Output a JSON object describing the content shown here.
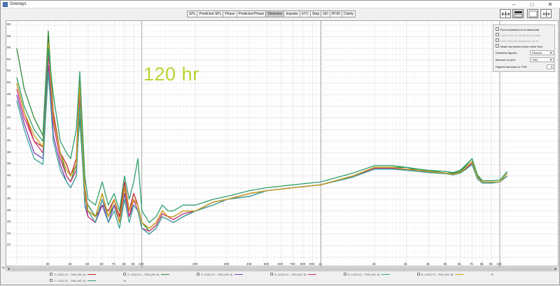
{
  "window": {
    "title": "Overlays"
  },
  "tabs": [
    "SPL",
    "Predicted SPL",
    "Phase",
    "Predicted Phase",
    "Distortion",
    "Impulse",
    "ETC",
    "Step",
    "GD",
    "RT60",
    "Clarity"
  ],
  "active_tab": "Distortion",
  "watermark": "120 hr",
  "options": {
    "plot_normalised": "Plot normalised to fundamental",
    "limit_norm": "Limit norm. to 30 dB below peak",
    "use_harmonic_freq": "Use harmonic frequency as ref",
    "mask_harmonics": "Mask harmonics below noise floor",
    "distortion_figures_label": "Distortion figures:",
    "distortion_figures_value": "Percent",
    "measure_to_plot_label": "Measure to plot:",
    "measure_to_plot_value": "THD",
    "highest_harmonic_label": "Highest harmonic in THD",
    "highest_harmonic_value": "9"
  },
  "y_position_readout": "80.41",
  "legend": [
    {
      "label": "1: LCD2 Cl... THD (H2..9)",
      "unit": "%",
      "color": "#c0272d"
    },
    {
      "label": "2: LCD2 Cl... THD (H2..9)",
      "unit": "%",
      "color": "#2f8a3a"
    },
    {
      "label": "3: LCD2 Cl... THD (H2..9)",
      "unit": "%",
      "color": "#7b3fb5"
    },
    {
      "label": "4: LCD2 Cl... THD (H2..9)",
      "unit": "%",
      "color": "#d6337a"
    },
    {
      "label": "5: LCD2 Cl... THD (H2..9)",
      "unit": "%",
      "color": "#3aa39a"
    },
    {
      "label": "6: LCD2 Cl... THD (H2..9)",
      "unit": "%",
      "color": "#c9a21a"
    },
    {
      "label": "7: LCD2 Cl... THD (H2..9)",
      "unit": "%",
      "color": "#2f9f6a"
    }
  ],
  "chart_data": {
    "type": "line",
    "title": "",
    "xlabel": "",
    "ylabel": "",
    "x_scale": "log",
    "xlim": [
      20,
      20000
    ],
    "ylim": [
      20,
      60
    ],
    "y_ticks": [
      22,
      24,
      26,
      28,
      30,
      32,
      34,
      36,
      38,
      40,
      42,
      44,
      46,
      48,
      50,
      52,
      54,
      56,
      58,
      60
    ],
    "x_tick_labels": [
      "30",
      "40",
      "50",
      "60",
      "70",
      "80",
      "90",
      "100",
      "200",
      "300",
      "400",
      "500",
      "600",
      "700",
      "800",
      "900",
      "1k",
      "2k",
      "3k",
      "4k",
      "5k",
      "6k",
      "7k",
      "8k",
      "9k",
      "10k"
    ],
    "x_ticks_hz": [
      30,
      40,
      50,
      60,
      70,
      80,
      90,
      100,
      200,
      300,
      400,
      500,
      600,
      700,
      800,
      900,
      1000,
      2000,
      3000,
      4000,
      5000,
      6000,
      7000,
      8000,
      9000,
      10000
    ],
    "x": [
      20,
      22,
      25,
      28,
      30,
      32,
      35,
      38,
      40,
      43,
      45,
      48,
      50,
      55,
      60,
      65,
      70,
      75,
      80,
      85,
      90,
      95,
      100,
      110,
      120,
      130,
      140,
      150,
      170,
      200,
      250,
      300,
      400,
      500,
      700,
      1000,
      1500,
      2000,
      2500,
      3000,
      3500,
      4000,
      5000,
      5500,
      6000,
      6500,
      7000,
      7500,
      8000,
      9000,
      10000,
      11000
    ],
    "series": [
      {
        "name": "1: LCD2 Cl... THD (H2..9)",
        "color": "#c0272d",
        "values": [
          50,
          45,
          40,
          39,
          58,
          45,
          38,
          36,
          34,
          37,
          51,
          32,
          28,
          27,
          29,
          28,
          30,
          27,
          33,
          28,
          31,
          29,
          26,
          25,
          26,
          28,
          27,
          27,
          28,
          28,
          29.5,
          30,
          31,
          31.5,
          32,
          32.5,
          34,
          35.5,
          35.5,
          35,
          35,
          34.8,
          34.5,
          34.3,
          34.6,
          35.5,
          36.5,
          34,
          33,
          33,
          33,
          34
        ]
      },
      {
        "name": "2: LCD2 Cl... THD (H2..9)",
        "color": "#2f8a3a",
        "values": [
          56,
          49,
          44,
          41,
          59,
          44,
          38,
          34,
          33,
          36,
          44,
          30,
          29,
          27,
          31,
          27,
          29,
          26,
          31,
          27,
          30,
          29,
          26,
          24.5,
          25.5,
          27.5,
          27,
          26.5,
          27.5,
          28,
          29.5,
          30,
          31,
          31.5,
          32,
          32.5,
          34,
          35.5,
          35.5,
          35.5,
          35,
          35,
          34.5,
          34.5,
          34.8,
          35.8,
          37,
          34,
          33,
          33,
          33,
          34.5
        ]
      },
      {
        "name": "3: LCD2 Cl... THD (H2..9)",
        "color": "#7b3fb5",
        "values": [
          48,
          43,
          38,
          37,
          53,
          41,
          36,
          33,
          32,
          34,
          47,
          29,
          27,
          26,
          29,
          26,
          29,
          26,
          31,
          27,
          29,
          28,
          25,
          24,
          25,
          27,
          26.5,
          26,
          27,
          28,
          29,
          30,
          30.5,
          31.5,
          32,
          32.5,
          33.8,
          35.3,
          35.3,
          35,
          35,
          34.7,
          34.4,
          34.3,
          34.5,
          35.3,
          36,
          33.5,
          32.8,
          32.8,
          33,
          34
        ]
      },
      {
        "name": "4: LCD2 Cl... THD (H2..9)",
        "color": "#d6337a",
        "values": [
          49,
          44,
          40,
          38,
          55,
          43,
          37,
          34,
          33,
          35,
          49,
          31,
          27,
          26,
          30,
          27,
          30,
          26,
          32,
          27,
          30,
          28,
          25,
          24.5,
          25.5,
          27.5,
          27,
          26.5,
          27.5,
          28,
          29.5,
          30,
          31,
          31.5,
          32,
          32.5,
          34,
          35.4,
          35.4,
          35.2,
          35,
          34.8,
          34.5,
          34.3,
          34.6,
          35.4,
          36.2,
          33.8,
          33,
          33,
          33,
          34
        ]
      },
      {
        "name": "5: LCD2 Cl... THD (H2..9)",
        "color": "#3aa39a",
        "values": [
          47,
          42,
          37,
          36,
          52,
          40,
          35,
          33,
          32,
          34,
          46,
          29,
          28,
          26,
          30,
          26,
          28,
          25,
          30,
          26,
          29,
          28,
          25,
          24,
          25,
          27,
          26.5,
          26,
          27,
          28,
          29,
          30,
          30.5,
          31.5,
          32,
          32.5,
          33.8,
          35.2,
          35.2,
          35,
          34.8,
          34.6,
          34.4,
          34.2,
          34.5,
          35.2,
          36,
          33.5,
          32.8,
          32.8,
          33,
          34
        ]
      },
      {
        "name": "6: LCD2 Cl... THD (H2..9)",
        "color": "#c9a21a",
        "values": [
          50,
          45,
          41,
          39,
          57,
          44,
          38,
          35,
          34,
          36,
          50,
          31,
          28,
          27,
          31,
          27,
          30,
          26,
          32,
          28,
          30,
          29,
          26,
          25,
          26,
          28,
          27,
          27,
          28,
          28,
          29.5,
          30,
          31,
          31.5,
          32,
          32.5,
          34,
          35.5,
          35.5,
          35.2,
          35,
          34.8,
          34.5,
          34.3,
          34.6,
          35.5,
          36.5,
          33.8,
          33,
          33,
          33,
          34.5
        ]
      },
      {
        "name": "7: LCD2 Cl... THD (H2..9)",
        "color": "#2f9f6a",
        "values": [
          51,
          46,
          42,
          40,
          56,
          48,
          40,
          38,
          37,
          42,
          52,
          34,
          30,
          29,
          33,
          29,
          31,
          28,
          34,
          30,
          33,
          37,
          28,
          26,
          27,
          29,
          28,
          28,
          29,
          29,
          30,
          30.5,
          31.5,
          32,
          32.5,
          33,
          34.5,
          35.8,
          35.8,
          35.5,
          35.2,
          35,
          34.8,
          34.6,
          35,
          36,
          37,
          34.2,
          33.2,
          33.2,
          33.3,
          34.8
        ]
      }
    ]
  }
}
